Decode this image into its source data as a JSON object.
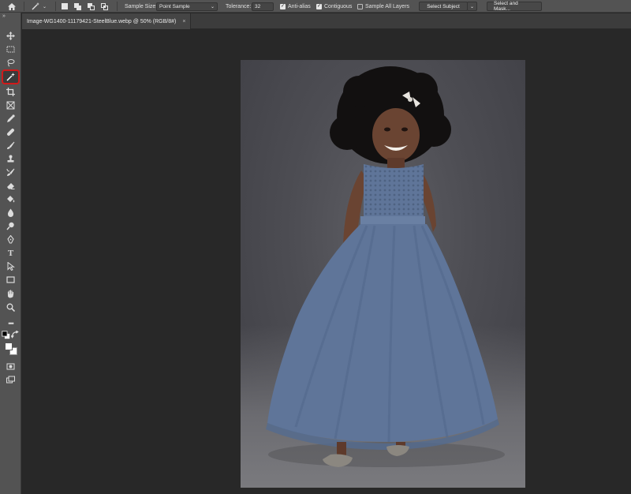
{
  "options_bar": {
    "sample_size_label": "Sample Size:",
    "sample_size_value": "Point Sample",
    "tolerance_label": "Tolerance:",
    "tolerance_value": "32",
    "anti_alias_label": "Anti-alias",
    "anti_alias_checked": true,
    "contiguous_label": "Contiguous",
    "contiguous_checked": true,
    "sample_all_layers_label": "Sample All Layers",
    "sample_all_layers_checked": false,
    "select_subject_label": "Select Subject",
    "select_and_mask_label": "Select and Mask..."
  },
  "document": {
    "tab_title": "Image-WG1400-11179421-SteelBlue.webp @ 50% (RGB/8#)",
    "close_glyph": "×"
  },
  "tools": [
    "move-tool",
    "marquee-tool",
    "lasso-tool",
    "magic-wand-tool",
    "crop-tool",
    "frame-tool",
    "eyedropper-tool",
    "healing-brush-tool",
    "brush-tool",
    "clone-stamp-tool",
    "history-brush-tool",
    "eraser-tool",
    "paint-bucket-tool",
    "blur-tool",
    "dodge-tool",
    "pen-tool",
    "type-tool",
    "path-selection-tool",
    "rectangle-tool",
    "hand-tool",
    "zoom-tool",
    "edit-toolbar",
    "default-colors",
    "foreground-background-color",
    "quick-mask",
    "screen-mode"
  ],
  "selected_tool": "magic-wand-tool",
  "colors": {
    "accent_highlight": "#d01a1a",
    "dress": "#5f7599",
    "backdrop": "#4d4d53"
  }
}
